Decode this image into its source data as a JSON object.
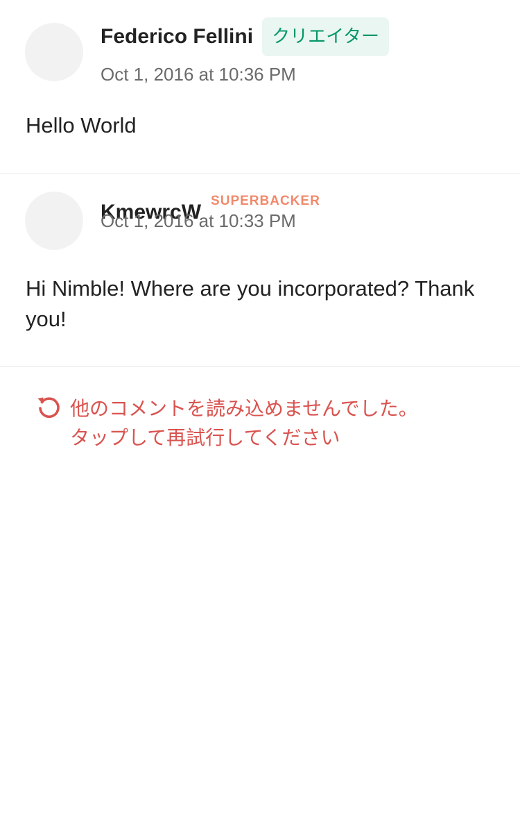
{
  "comments": [
    {
      "author": "Federico Fellini",
      "badge": "クリエイター",
      "timestamp": "Oct 1, 2016 at 10:36 PM",
      "body": "Hello World"
    },
    {
      "author": "KmewrcW",
      "badge": "SUPERBACKER",
      "timestamp": "Oct 1, 2016 at 10:33 PM",
      "body": "Hi Nimble! Where are you incorporated? Thank you!"
    }
  ],
  "retry": {
    "icon": "retry-icon",
    "line1": "他のコメントを読み込めませんでした。",
    "line2": "タップして再試行してください"
  },
  "colors": {
    "creator_badge_bg": "#eaf6f1",
    "creator_badge_text": "#059669",
    "superbacker": "#f2896b",
    "error": "#d9534f"
  }
}
